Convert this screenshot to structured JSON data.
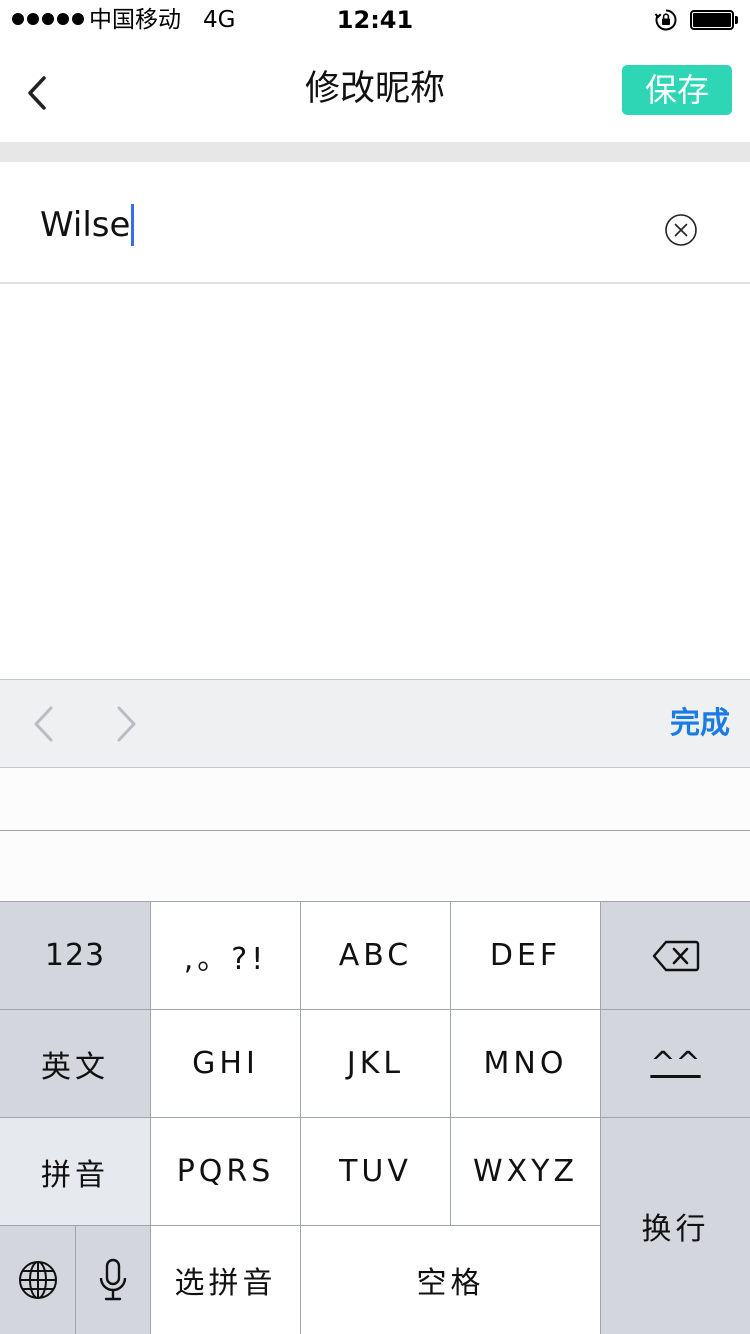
{
  "status_bar": {
    "carrier": "中国移动",
    "network": "4G",
    "time": "12:41",
    "signal_icon": "signal-dots-icon",
    "lock_icon": "rotation-lock-icon",
    "battery_icon": "battery-full-icon",
    "battery_level": 1.0
  },
  "nav": {
    "title": "修改昵称",
    "back_icon": "chevron-left-icon",
    "save_label": "保存",
    "save_color": "#2fd6b5"
  },
  "nickname": {
    "value": "Wilse",
    "clear_icon": "clear-circle-icon",
    "caret_color": "#3a6cf0"
  },
  "accessory": {
    "prev_icon": "chevron-left-icon",
    "next_icon": "chevron-right-icon",
    "done_label": "完成",
    "done_color": "#1b7be4"
  },
  "keyboard": {
    "row1": [
      "123",
      ",。?!",
      "ABC",
      "DEF"
    ],
    "row2": [
      "英文",
      "GHI",
      "JKL",
      "MNO",
      "^^"
    ],
    "row3": [
      "拼音",
      "PQRS",
      "TUV",
      "WXYZ"
    ],
    "row4": [
      "选拼音",
      "空格"
    ],
    "return_label": "换行",
    "delete_icon": "backspace-icon",
    "globe_icon": "globe-icon",
    "mic_icon": "microphone-icon"
  }
}
